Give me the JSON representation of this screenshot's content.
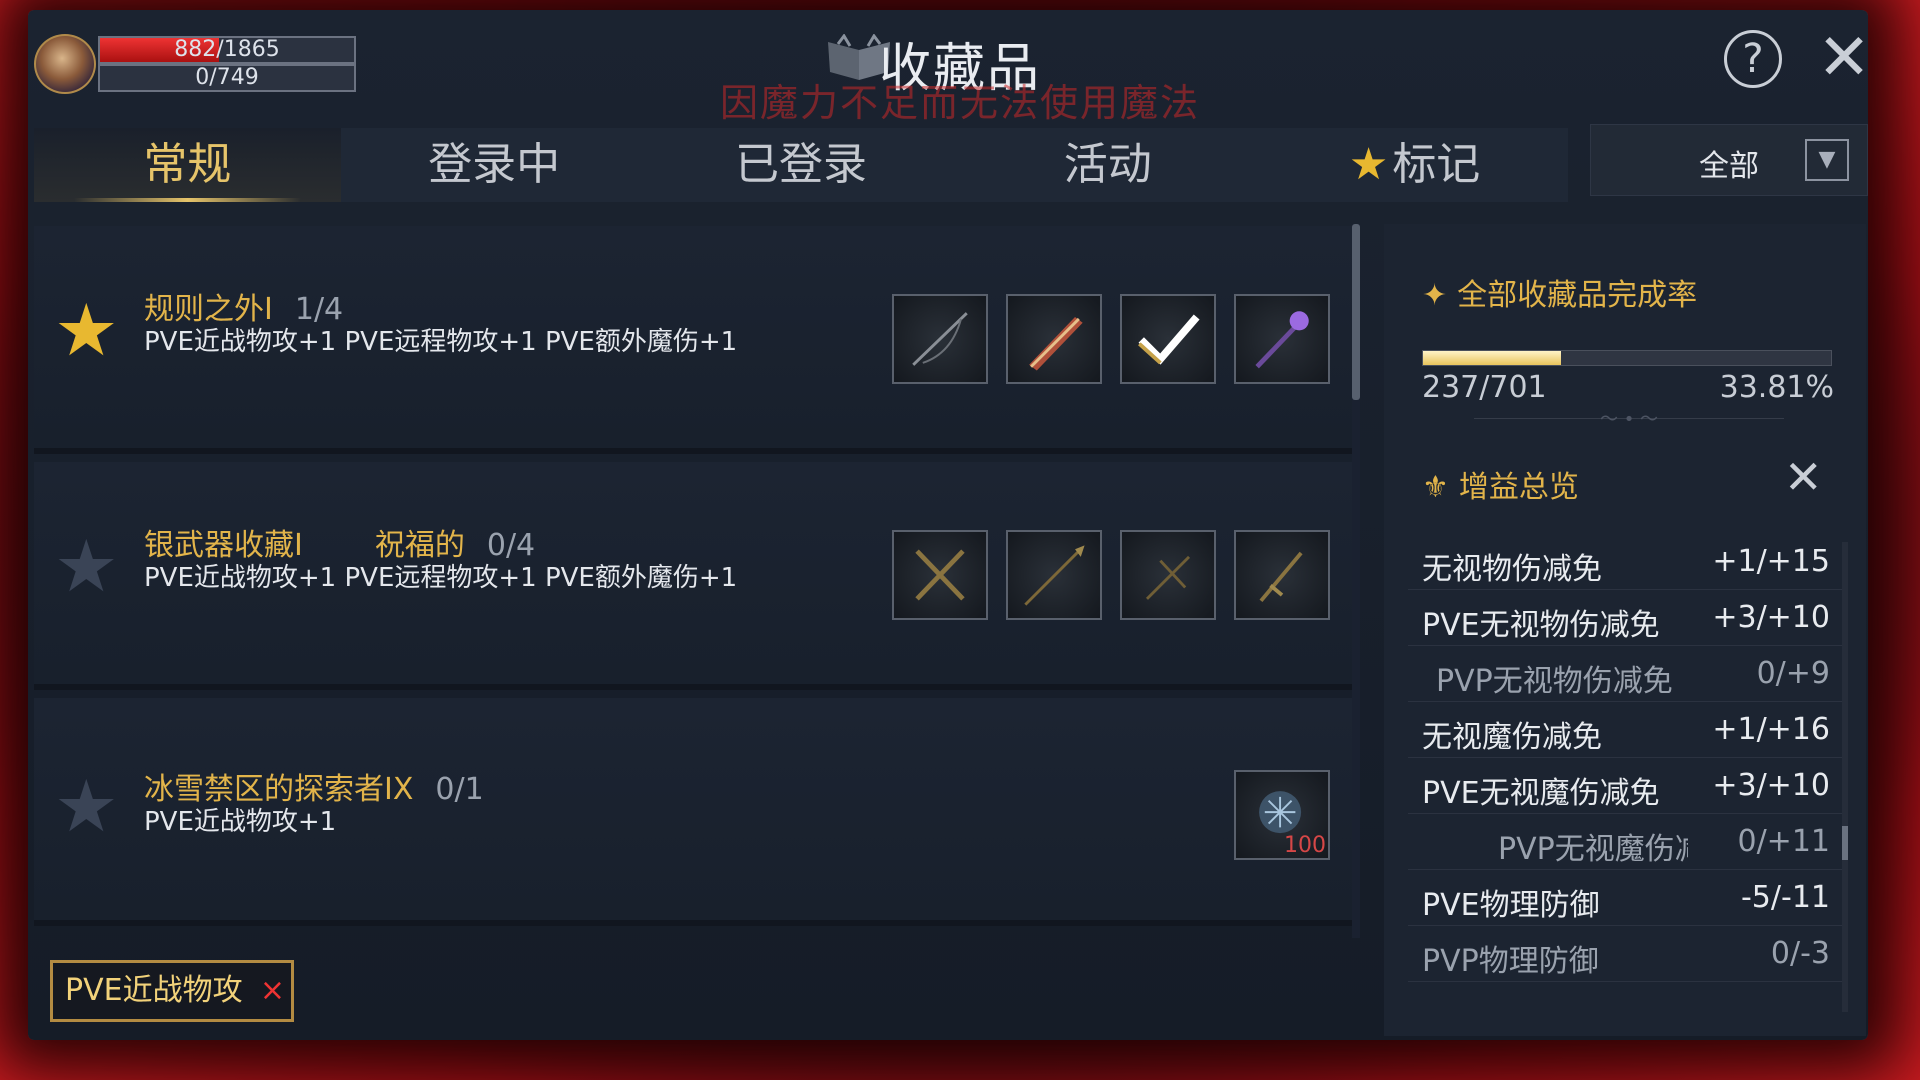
{
  "player": {
    "hp": "882/1865",
    "hp_fraction": 0.47,
    "mp": "0/749",
    "mp_fraction": 0.0
  },
  "header": {
    "title": "收藏品",
    "warning": "因魔力不足而无法使用魔法",
    "help_icon": "help-icon",
    "close_icon": "close-icon"
  },
  "tabs": [
    {
      "label": "常规",
      "active": true
    },
    {
      "label": "登录中",
      "active": false
    },
    {
      "label": "已登录",
      "active": false
    },
    {
      "label": "活动",
      "active": false
    },
    {
      "label": "标记",
      "active": false,
      "icon": "star-icon"
    }
  ],
  "filter": {
    "selected": "全部"
  },
  "collections": [
    {
      "favorite": true,
      "name": "规则之外I",
      "tag": "",
      "count": "1/4",
      "effects": "PVE近战物攻+1 PVE远程物攻+1 PVE额外魔伤+1",
      "items": [
        "bow-icon",
        "sword-icon",
        "checkmark-icon",
        "staff-icon"
      ]
    },
    {
      "favorite": false,
      "name": "银武器收藏I",
      "tag": "祝福的",
      "count": "0/4",
      "effects": "PVE近战物攻+1 PVE远程物攻+1 PVE额外魔伤+1",
      "items": [
        "crossed-blades-icon",
        "spear-icon",
        "crossbow-icon",
        "dagger-icon"
      ]
    },
    {
      "favorite": false,
      "name": "冰雪禁区的探索者IX",
      "tag": "",
      "count": "0/1",
      "effects": "PVE近战物攻+1",
      "items": [
        "ice-crystal-icon"
      ],
      "item_badge": "100"
    }
  ],
  "active_filter_chip": {
    "label": "PVE近战物攻",
    "remove": "×"
  },
  "completion": {
    "title": "全部收藏品完成率",
    "collected": "237/701",
    "percent": "33.81%",
    "fraction": 0.338
  },
  "buffs": {
    "title": "增益总览",
    "rows": [
      {
        "name": "无视物伤减免",
        "value": "+1/+15",
        "style": ""
      },
      {
        "name": "PVE无视物伤减免",
        "value": "+3/+10",
        "style": ""
      },
      {
        "name": "PVP无视物伤减免",
        "value": "0/+9",
        "style": "dim sub"
      },
      {
        "name": "无视魔伤减免",
        "value": "+1/+16",
        "style": ""
      },
      {
        "name": "PVE无视魔伤减免",
        "value": "+3/+10",
        "style": ""
      },
      {
        "name": "PVP无视魔伤减免",
        "value": "0/+11",
        "style": "dim sub2"
      },
      {
        "name": "PVE物理防御",
        "value": "-5/-11",
        "style": ""
      },
      {
        "name": "PVP物理防御",
        "value": "0/-3",
        "style": "dim"
      }
    ]
  }
}
